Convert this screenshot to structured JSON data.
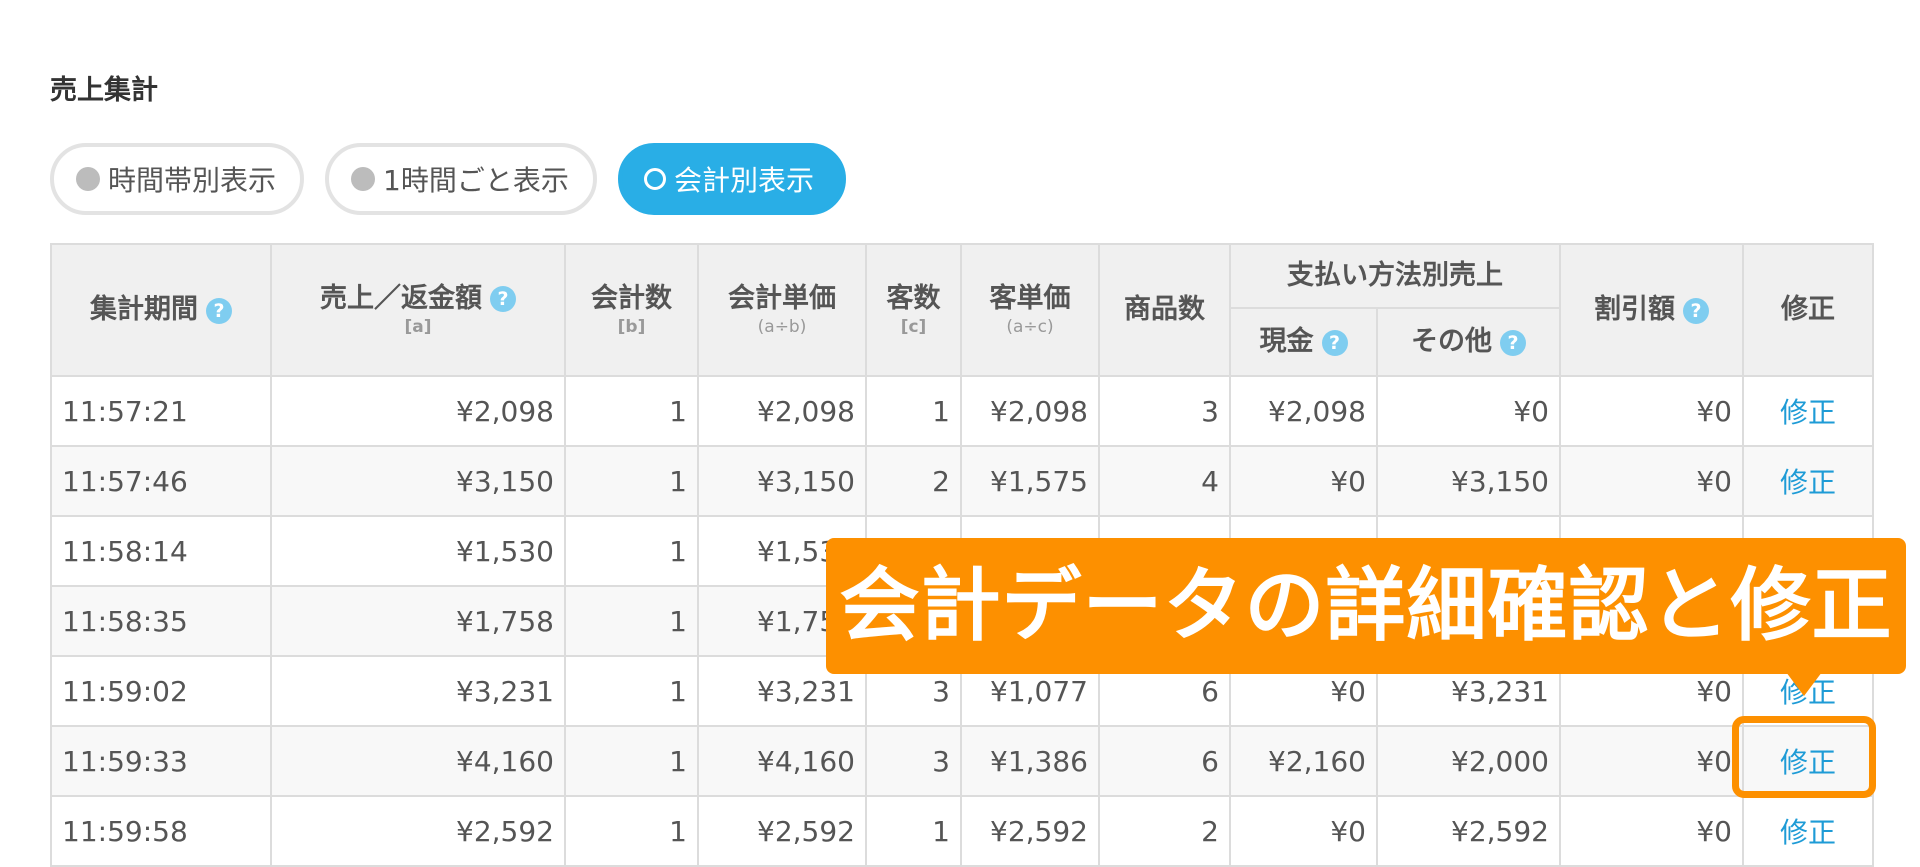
{
  "section_title": "売上集計",
  "view_toggle": [
    {
      "label": "時間帯別表示",
      "active": false
    },
    {
      "label": "1時間ごと表示",
      "active": false
    },
    {
      "label": "会計別表示",
      "active": true
    }
  ],
  "table": {
    "headers": {
      "period": "集計期間",
      "sales": "売上／返金額",
      "sales_sub": "[a]",
      "count": "会計数",
      "count_sub": "[b]",
      "unit_price": "会計単価",
      "unit_price_sub": "(a÷b)",
      "customers": "客数",
      "customers_sub": "[c]",
      "customer_price": "客単価",
      "customer_price_sub": "(a÷c)",
      "items": "商品数",
      "payment_group": "支払い方法別売上",
      "cash": "現金",
      "other": "その他",
      "discount": "割引額",
      "edit": "修正"
    },
    "help_icon": "?",
    "rows": [
      [
        "11:57:21",
        "¥2,098",
        "1",
        "¥2,098",
        "1",
        "¥2,098",
        "3",
        "¥2,098",
        "¥0",
        "¥0",
        "修正"
      ],
      [
        "11:57:46",
        "¥3,150",
        "1",
        "¥3,150",
        "2",
        "¥1,575",
        "4",
        "¥0",
        "¥3,150",
        "¥0",
        "修正"
      ],
      [
        "11:58:14",
        "¥1,530",
        "1",
        "¥1,530",
        "",
        "",
        "",
        "",
        "",
        "",
        ""
      ],
      [
        "11:58:35",
        "¥1,758",
        "1",
        "¥1,758",
        "",
        "",
        "",
        "",
        "",
        "",
        ""
      ],
      [
        "11:59:02",
        "¥3,231",
        "1",
        "¥3,231",
        "3",
        "¥1,077",
        "6",
        "¥0",
        "¥3,231",
        "¥0",
        "修正"
      ],
      [
        "11:59:33",
        "¥4,160",
        "1",
        "¥4,160",
        "3",
        "¥1,386",
        "6",
        "¥2,160",
        "¥2,000",
        "¥0",
        "修正"
      ],
      [
        "11:59:58",
        "¥2,592",
        "1",
        "¥2,592",
        "1",
        "¥2,592",
        "2",
        "¥0",
        "¥2,592",
        "¥0",
        "修正"
      ]
    ]
  },
  "callout": {
    "text": "会計データの詳細確認と修正",
    "color": "#fd9000"
  },
  "colors": {
    "accent": "#29aee6",
    "link": "#1e9bd6",
    "help": "#7fcdf0"
  }
}
